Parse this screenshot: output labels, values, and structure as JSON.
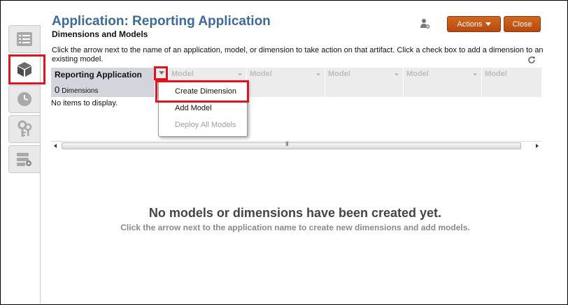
{
  "header": {
    "title": "Application: Reporting Application",
    "subtitle": "Dimensions and Models"
  },
  "toolbar": {
    "actions_label": "Actions",
    "close_label": "Close"
  },
  "instructions": "Click the arrow next to the name of an application, model, or dimension to take action on that artifact. Click a check box to add a dimension to an existing model.",
  "grid": {
    "app_name": "Reporting Application",
    "dimension_count": "0",
    "dimension_label": "Dimensions",
    "model_columns": [
      "Model",
      "Model",
      "Model",
      "Model",
      "Model"
    ],
    "no_items": "No items to display.",
    "scroll_grip": "III"
  },
  "menu": {
    "items": [
      {
        "label": "Create Dimension",
        "enabled": true
      },
      {
        "label": "Add Model",
        "enabled": true
      },
      {
        "label": "Deploy All Models",
        "enabled": false
      }
    ]
  },
  "empty_state": {
    "title": "No models or dimensions have been created yet.",
    "subtitle": "Click the arrow next to the application name to create new dimensions and add models."
  },
  "colors": {
    "accent_title": "#3d6a99",
    "button": "#c85a1a",
    "highlight": "#e0141e"
  },
  "nav": {
    "tabs": [
      "list-icon",
      "cube-icon",
      "clock-icon",
      "keys-icon",
      "server-settings-icon"
    ],
    "active": "cube-icon"
  }
}
